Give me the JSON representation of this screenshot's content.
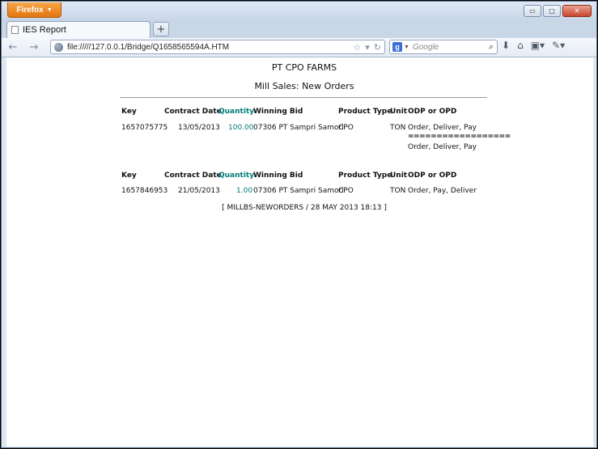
{
  "browser": {
    "menu_button": "Firefox",
    "window_controls": {
      "minimize": "▭",
      "maximize": "□",
      "close": "✕"
    },
    "tab": {
      "title": "IES Report"
    },
    "new_tab": "+",
    "url": "file://///127.0.0.1/Bridge/Q1658565594A.HTM",
    "search_placeholder": "Google"
  },
  "report": {
    "title": "PT CPO FARMS",
    "subtitle": "Mill Sales: New Orders",
    "headers": {
      "key": "Key",
      "contract_date": "Contract Date",
      "quantity": "Quantity",
      "winning_bid": "Winning Bid",
      "product_type": "Product Type",
      "unit": "Unit",
      "odp": "ODP or OPD"
    },
    "orders": [
      {
        "key": "1657075775",
        "contract_date": "13/05/2013",
        "quantity": "100.00",
        "winning_bid": "07306 PT Sampri Samori",
        "product_type": "CPO",
        "unit": "TON",
        "odp": "Order, Deliver, Pay",
        "separator": "==================",
        "odp_total": "Order, Deliver, Pay"
      },
      {
        "key": "1657846953",
        "contract_date": "21/05/2013",
        "quantity": "1.00",
        "winning_bid": "07306 PT Sampri Samori",
        "product_type": "CPO",
        "unit": "TON",
        "odp": "Order, Pay, Deliver"
      }
    ],
    "footer": "[ MILLBS-NEWORDERS / 28 MAY 2013 18:13 ]"
  },
  "colors": {
    "accent_quantity": "#007b7b",
    "firefox_orange": "#e2760f"
  }
}
